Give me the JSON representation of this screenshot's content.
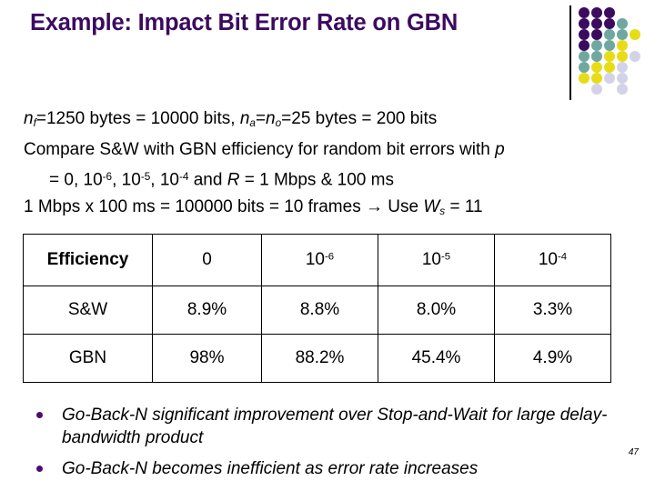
{
  "slide": {
    "title": "Example:  Impact Bit Error Rate on GBN",
    "title_color": "#3B0B60",
    "page_number": "47"
  },
  "decor": {
    "name": "dot-grid-decoration",
    "colors": {
      "purple": "#3B0B60",
      "teal": "#6FA8A0",
      "yellow": "#E8DC18",
      "lavender": "#D3D3E8"
    },
    "dots": [
      {
        "col": 0,
        "row": 0,
        "color": "#3B0B60"
      },
      {
        "col": 1,
        "row": 0,
        "color": "#3B0B60"
      },
      {
        "col": 2,
        "row": 0,
        "color": "#3B0B60"
      },
      {
        "col": 0,
        "row": 1,
        "color": "#3B0B60"
      },
      {
        "col": 1,
        "row": 1,
        "color": "#3B0B60"
      },
      {
        "col": 2,
        "row": 1,
        "color": "#3B0B60"
      },
      {
        "col": 3,
        "row": 1,
        "color": "#6FA8A0"
      },
      {
        "col": 0,
        "row": 2,
        "color": "#3B0B60"
      },
      {
        "col": 1,
        "row": 2,
        "color": "#3B0B60"
      },
      {
        "col": 2,
        "row": 2,
        "color": "#6FA8A0"
      },
      {
        "col": 3,
        "row": 2,
        "color": "#6FA8A0"
      },
      {
        "col": 4,
        "row": 2,
        "color": "#E8DC18"
      },
      {
        "col": 0,
        "row": 3,
        "color": "#3B0B60"
      },
      {
        "col": 1,
        "row": 3,
        "color": "#6FA8A0"
      },
      {
        "col": 2,
        "row": 3,
        "color": "#6FA8A0"
      },
      {
        "col": 3,
        "row": 3,
        "color": "#E8DC18"
      },
      {
        "col": 0,
        "row": 4,
        "color": "#6FA8A0"
      },
      {
        "col": 1,
        "row": 4,
        "color": "#6FA8A0"
      },
      {
        "col": 2,
        "row": 4,
        "color": "#E8DC18"
      },
      {
        "col": 3,
        "row": 4,
        "color": "#E8DC18"
      },
      {
        "col": 4,
        "row": 4,
        "color": "#D3D3E8"
      },
      {
        "col": 0,
        "row": 5,
        "color": "#6FA8A0"
      },
      {
        "col": 1,
        "row": 5,
        "color": "#E8DC18"
      },
      {
        "col": 2,
        "row": 5,
        "color": "#E8DC18"
      },
      {
        "col": 3,
        "row": 5,
        "color": "#D3D3E8"
      },
      {
        "col": 0,
        "row": 6,
        "color": "#E8DC18"
      },
      {
        "col": 1,
        "row": 6,
        "color": "#E8DC18"
      },
      {
        "col": 2,
        "row": 6,
        "color": "#D3D3E8"
      },
      {
        "col": 3,
        "row": 6,
        "color": "#D3D3E8"
      },
      {
        "col": 1,
        "row": 7,
        "color": "#D3D3E8"
      },
      {
        "col": 3,
        "row": 7,
        "color": "#D3D3E8"
      }
    ]
  },
  "body": {
    "line1": {
      "var_n": "n",
      "sub_f": "f",
      "mid1": "=1250 bytes = 10000 bits, ",
      "var_n2": "n",
      "sub_a": "a",
      "eq1": "=",
      "var_n3": "n",
      "sub_o": "o",
      "tail": "=25 bytes = 200 bits"
    },
    "line2": {
      "text": "Compare S&W with GBN efficiency for random bit errors with ",
      "var_p": "p"
    },
    "line3": {
      "lead": "= 0, 10",
      "sup1": "-6",
      "sep1": ", 10",
      "sup2": "-5",
      "sep2": ", 10",
      "sup3": "-4",
      "mid": " and  ",
      "var_R": "R",
      "tail": " = 1 Mbps & 100 ms"
    },
    "line4": {
      "lead": "1 Mbps x 100 ms = 100000 bits = 10 frames → Use ",
      "var_W": "W",
      "sub_s": "s",
      "tail": " = 11"
    }
  },
  "table": {
    "header_label": "Efficiency",
    "header_values": [
      {
        "base": "0",
        "exp": ""
      },
      {
        "base": "10",
        "exp": "-6"
      },
      {
        "base": "10",
        "exp": "-5"
      },
      {
        "base": "10",
        "exp": "-4"
      }
    ],
    "rows": [
      {
        "label": "S&W",
        "cells": [
          {
            "value": "8.9%",
            "color": "red"
          },
          {
            "value": "8.8%",
            "color": "red"
          },
          {
            "value": "8.0%",
            "color": "red"
          },
          {
            "value": "3.3%",
            "color": "red"
          }
        ]
      },
      {
        "label": "GBN",
        "cells": [
          {
            "value": "98%",
            "color": "black"
          },
          {
            "value": "88.2%",
            "color": "black"
          },
          {
            "value": "45.4%",
            "color": "black"
          },
          {
            "value": "4.9%",
            "color": "red"
          }
        ]
      }
    ],
    "red_color": "#C0391B",
    "header_label_color": "#3B0B60"
  },
  "bullets": {
    "marker_color": "#4B0C72",
    "items": [
      "Go-Back-N significant improvement over Stop-and-Wait for large delay-bandwidth product",
      "Go-Back-N becomes inefficient as error rate increases"
    ]
  }
}
